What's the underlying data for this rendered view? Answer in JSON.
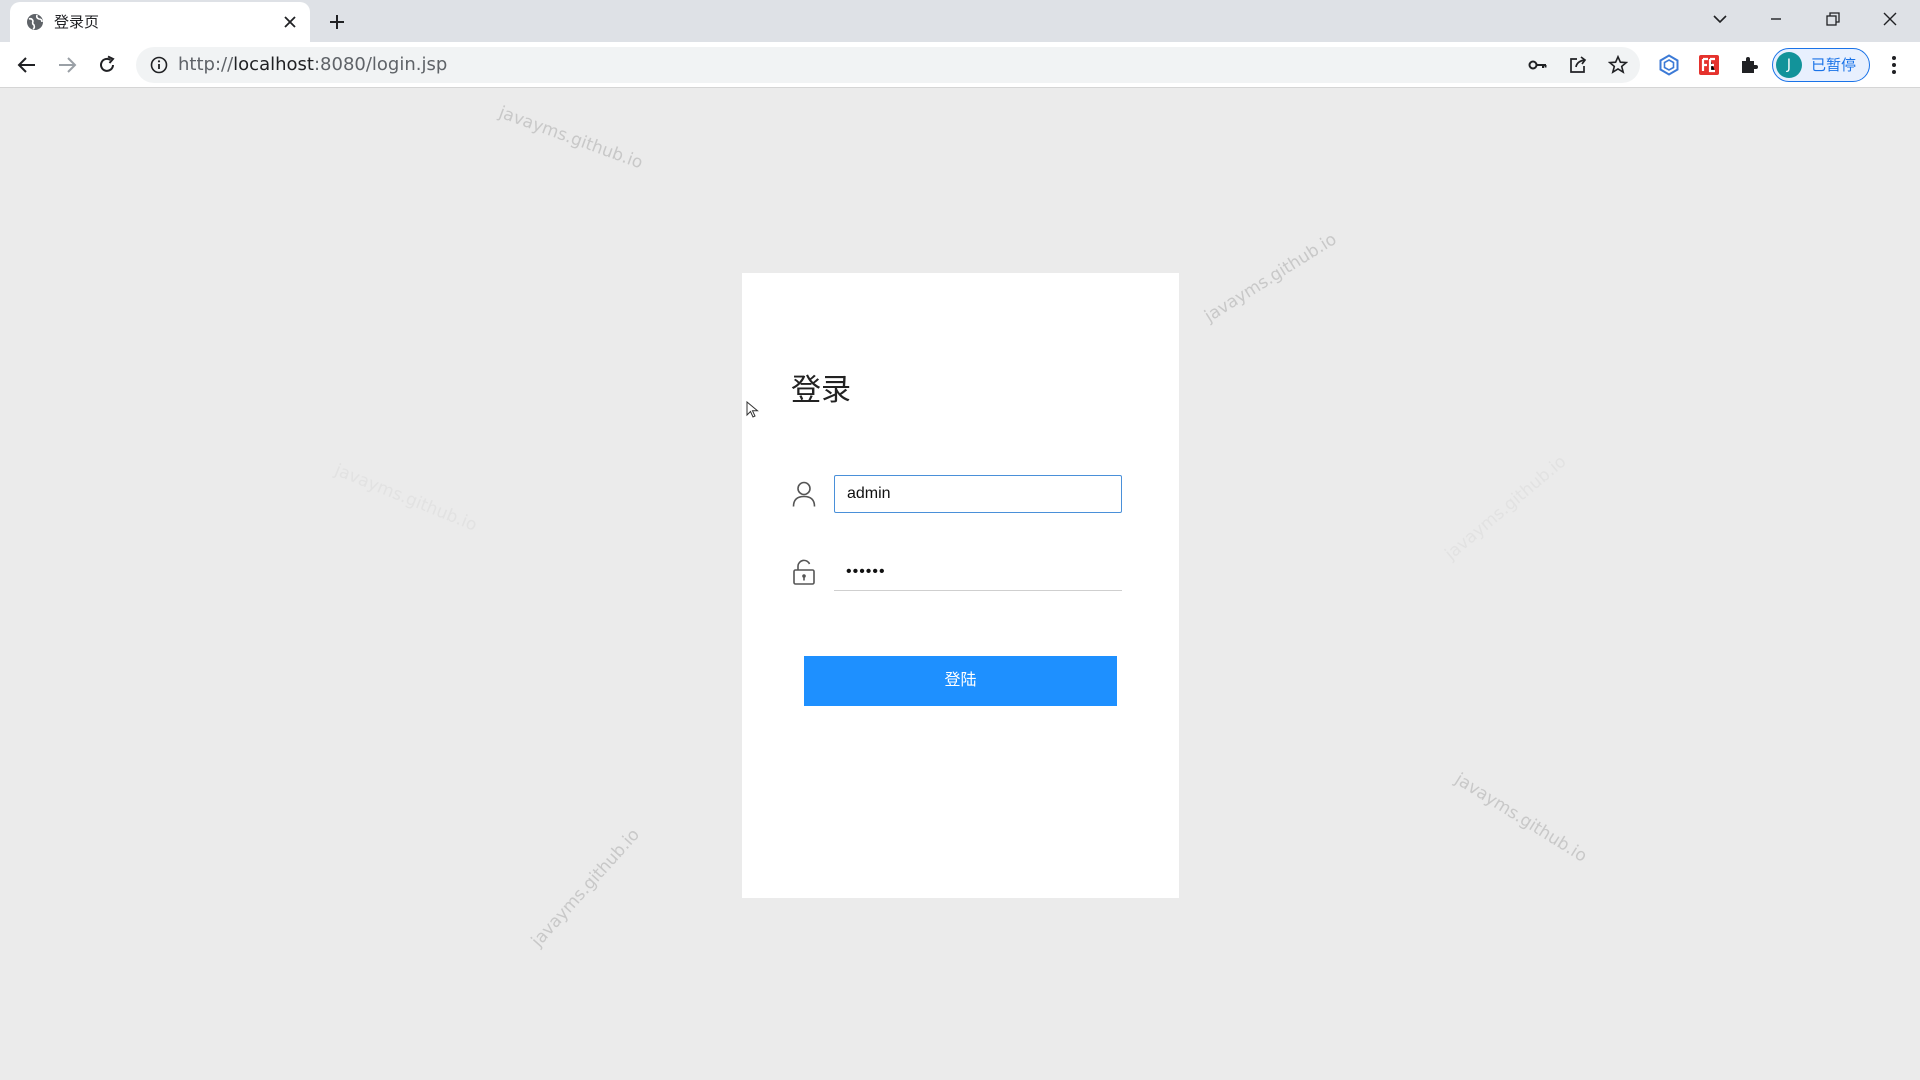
{
  "tab": {
    "title": "登录页",
    "favicon_icon": "globe-icon"
  },
  "toolbar": {
    "url_scheme": "http://",
    "url_host": "localhost",
    "url_rest": ":8080/login.jsp",
    "profile_initial": "J",
    "profile_label": "已暂停",
    "accent_color": "#1a73e8"
  },
  "watermark": {
    "text": "javayms.github.io"
  },
  "login": {
    "title": "登录",
    "username_value": "admin",
    "password_value": "••••••",
    "button_label": "登陆",
    "button_color": "#1e90ff"
  }
}
